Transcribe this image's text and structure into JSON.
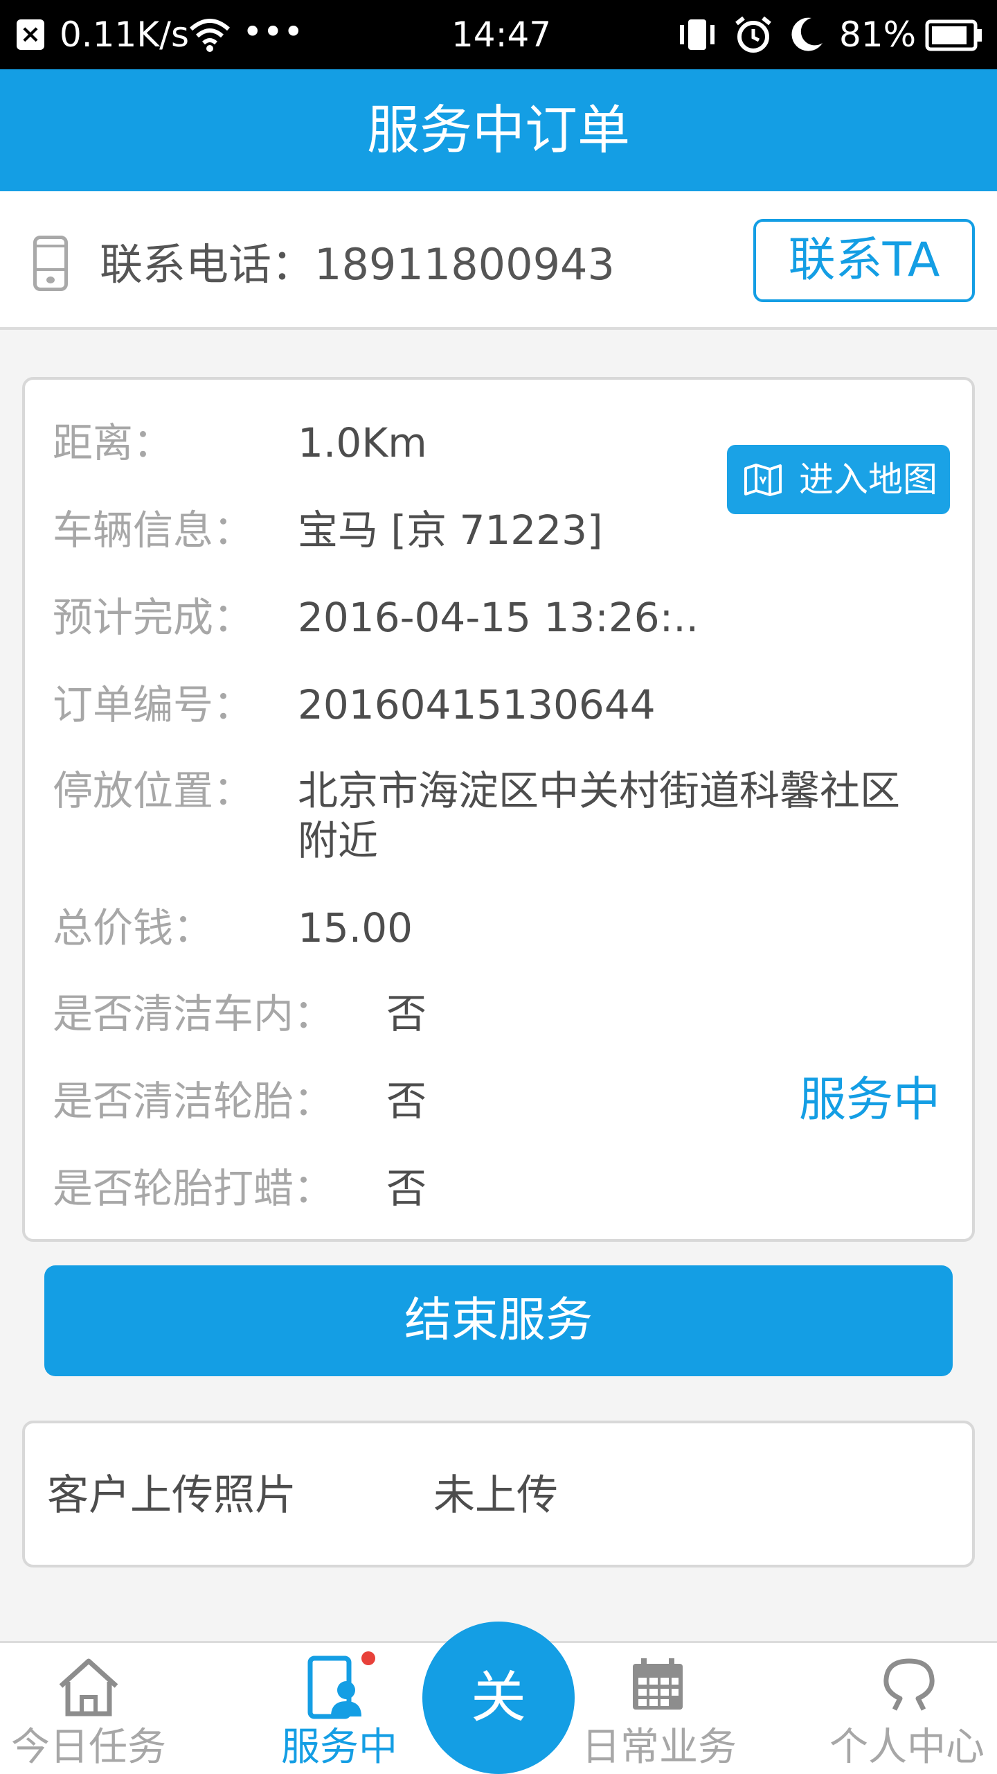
{
  "status_bar": {
    "speed": "0.11K/s",
    "more": "•••",
    "time": "14:47",
    "battery": "81%"
  },
  "header": {
    "title": "服务中订单"
  },
  "contact": {
    "label": "联系电话：18911800943",
    "button": "联系TA"
  },
  "order": {
    "rows": [
      {
        "label": "距离：",
        "value": "1.0Km"
      },
      {
        "label": "车辆信息：",
        "value": "宝马 [京 71223]"
      },
      {
        "label": "预计完成：",
        "value": "2016-04-15 13:26:.."
      },
      {
        "label": "订单编号：",
        "value": "20160415130644"
      },
      {
        "label": "停放位置：",
        "value_line1": "北京市海淀区中关村街道科馨社区",
        "value_line2": "附近"
      },
      {
        "label": "总价钱：",
        "value": "15.00"
      },
      {
        "label": "是否清洁车内：",
        "value": "否"
      },
      {
        "label": "是否清洁轮胎：",
        "value": "否"
      },
      {
        "label": "是否轮胎打蜡：",
        "value": "否"
      }
    ],
    "map_button": "进入地图",
    "status": "服务中"
  },
  "end_service_button": "结束服务",
  "photo": {
    "label": "客户上传照片",
    "value": "未上传"
  },
  "bottom_nav": {
    "items": [
      {
        "label": "今日任务",
        "icon": "home-icon"
      },
      {
        "label": "服务中",
        "icon": "service-icon"
      },
      {
        "label": "日常业务",
        "icon": "calendar-icon"
      },
      {
        "label": "个人中心",
        "icon": "user-icon"
      }
    ],
    "center_label": "关"
  },
  "colors": {
    "accent": "#149ee4",
    "badge": "#e8413a"
  }
}
